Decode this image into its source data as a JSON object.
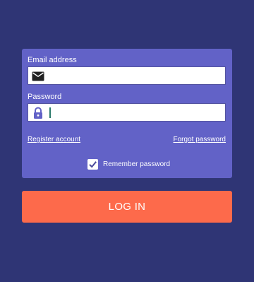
{
  "form": {
    "email_label": "Email address",
    "email_value": "",
    "email_placeholder": "",
    "email_icon": "envelope-icon",
    "password_label": "Password",
    "password_value": "",
    "password_placeholder": "",
    "password_icon": "lock-icon",
    "register_link": "Register account",
    "forgot_link": "Forgot password",
    "remember_label": "Remember password",
    "remember_checked": true,
    "login_label": "LOG IN"
  },
  "colors": {
    "background": "#2f3575",
    "card": "#6262c7",
    "accent": "#fd6a4b",
    "lock_icon": "#6262c7"
  }
}
